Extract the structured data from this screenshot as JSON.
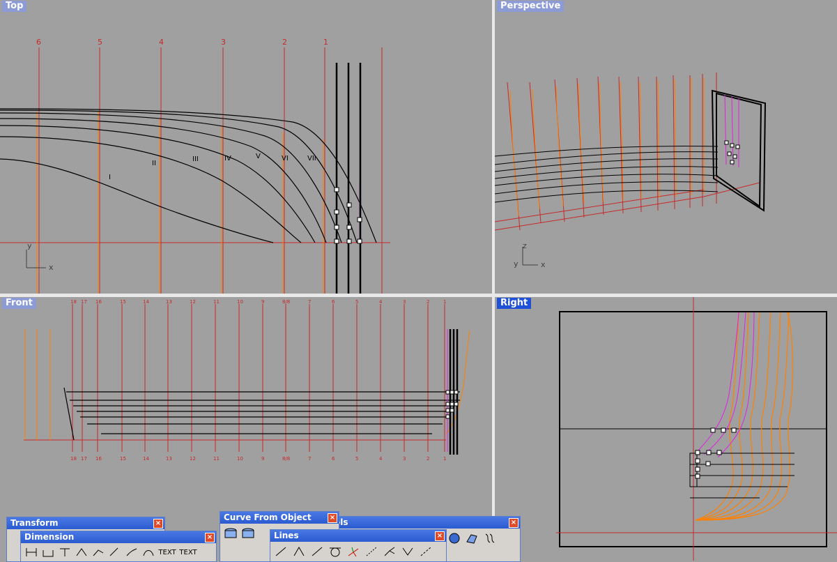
{
  "viewports": {
    "top": {
      "label": "Top",
      "station_labels": [
        "6",
        "5",
        "4",
        "3",
        "2",
        "1"
      ],
      "waterline_labels": [
        "I",
        "II",
        "III",
        "IV",
        "V",
        "VI",
        "VII"
      ],
      "axis": {
        "y": "y",
        "x": "x"
      }
    },
    "perspective": {
      "label": "Perspective",
      "axis": {
        "z": "z",
        "y": "y",
        "x": "x"
      }
    },
    "front": {
      "label": "Front",
      "station_labels": [
        "18",
        "17",
        "16",
        "15",
        "14",
        "13",
        "12",
        "11",
        "10",
        "9",
        "8/8",
        "7",
        "6",
        "5",
        "4",
        "3",
        "2",
        "1"
      ],
      "station_labels_bottom": [
        "18",
        "17",
        "16",
        "15",
        "14",
        "13",
        "12",
        "11",
        "10",
        "9",
        "8/8",
        "7",
        "6",
        "5",
        "4",
        "3",
        "2",
        "1"
      ]
    },
    "right": {
      "label": "Right"
    }
  },
  "toolbars": {
    "transform": {
      "title": "Transform"
    },
    "dimension": {
      "title": "Dimension",
      "text_label_1": "TEXT",
      "text_label_2": "TEXT"
    },
    "curve_from_object": {
      "title": "Curve From Object"
    },
    "tools": {
      "title": "ols"
    },
    "lines": {
      "title": "Lines"
    }
  },
  "colors": {
    "viewport_bg": "#a0a0a0",
    "station_line": "#c82828",
    "orange_curve": "#ff8000",
    "magenta_curve": "#e020e0",
    "black_curve": "#000000",
    "active_label": "#1f50d8",
    "inactive_label": "#8c9bd6"
  }
}
